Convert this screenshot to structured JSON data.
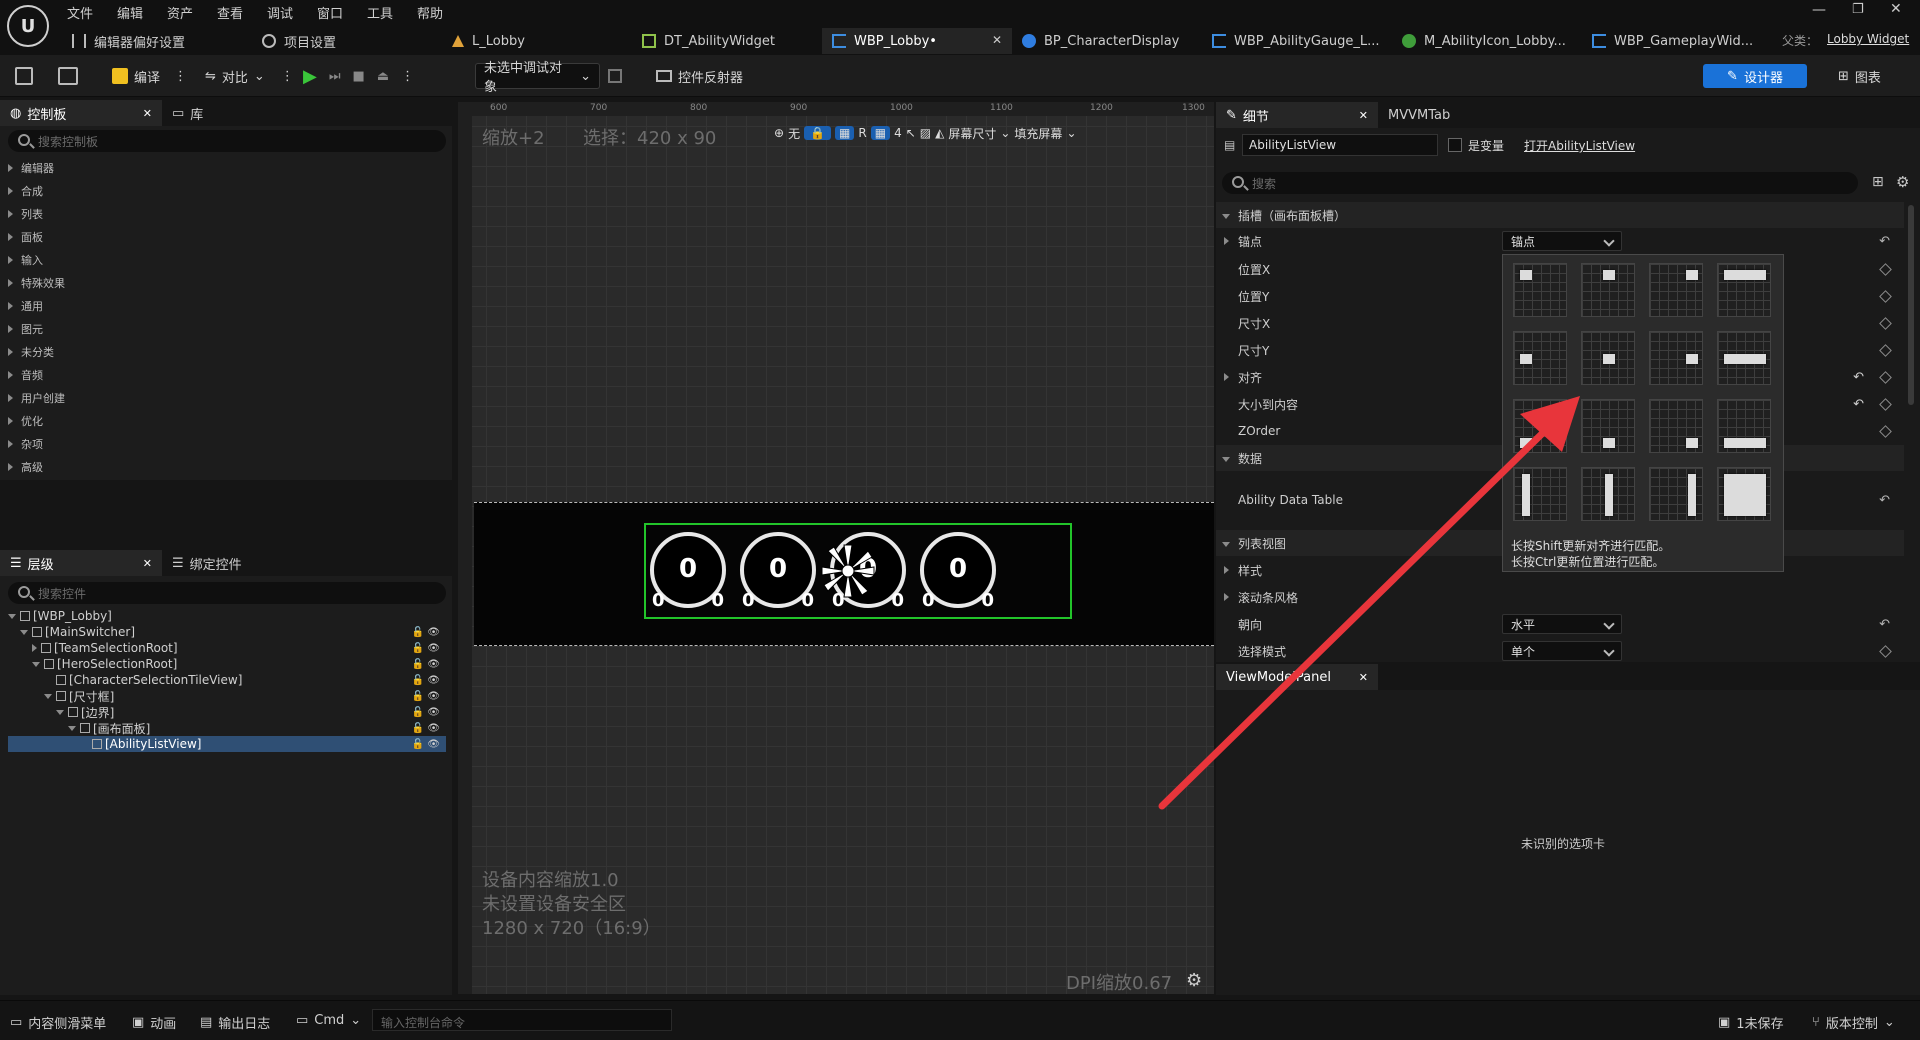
{
  "menu": [
    "文件",
    "编辑",
    "资产",
    "查看",
    "调试",
    "窗口",
    "工具",
    "帮助"
  ],
  "tabs": [
    {
      "label": "编辑器偏好设置"
    },
    {
      "label": "项目设置"
    },
    {
      "label": "L_Lobby"
    },
    {
      "label": "DT_AbilityWidget"
    },
    {
      "label": "WBP_Lobby•"
    },
    {
      "label": "BP_CharacterDisplay"
    },
    {
      "label": "WBP_AbilityGauge_L..."
    },
    {
      "label": "M_AbilityIcon_Lobby..."
    },
    {
      "label": "WBP_GameplayWid..."
    }
  ],
  "parent_class": {
    "label": "父类：",
    "value": "Lobby Widget"
  },
  "toolbar": {
    "compile": "编译",
    "diff": "对比",
    "debug_object": "未选中调试对象",
    "widget_reflector": "控件反射器",
    "designer": "设计器",
    "graph": "图表"
  },
  "palette": {
    "tab": "控制板",
    "library_tab": "库",
    "search_placeholder": "搜索控制板",
    "categories": [
      "编辑器",
      "合成",
      "列表",
      "面板",
      "输入",
      "特殊效果",
      "通用",
      "图元",
      "未分类",
      "音频",
      "用户创建",
      "优化",
      "杂项",
      "高级"
    ]
  },
  "hierarchy": {
    "tab": "层级",
    "bind_tab": "绑定控件",
    "search_placeholder": "搜索控件",
    "items": [
      {
        "label": "[WBP_Lobby]"
      },
      {
        "label": "[MainSwitcher]"
      },
      {
        "label": "[TeamSelectionRoot]"
      },
      {
        "label": "[HeroSelectionRoot]"
      },
      {
        "label": "[CharacterSelectionTileView]"
      },
      {
        "label": "[尺寸框]"
      },
      {
        "label": "[边界]"
      },
      {
        "label": "[画布面板]"
      },
      {
        "label": "[AbilityListView]"
      }
    ]
  },
  "viewport": {
    "zoom": "缩放+2",
    "selection": "选择：420 x 90",
    "ruler": [
      "600",
      "700",
      "800",
      "900",
      "1000",
      "1100",
      "1200",
      "1300"
    ],
    "none_label": "无",
    "r_label": "R",
    "grid_num": "4",
    "screen_size": "屏幕尺寸",
    "fill_screen": "填充屏幕",
    "device_scale": "设备内容缩放1.0",
    "safe_zone": "未设置设备安全区",
    "resolution": "1280 x 720（16:9）",
    "dpi": "DPI缩放0.67",
    "ability_icons": [
      {
        "center": "0",
        "left": "0",
        "right": "0"
      },
      {
        "center": "0",
        "left": "0",
        "right": "0"
      },
      {
        "center": "0",
        "left": "0",
        "right": "0"
      },
      {
        "center": "0",
        "left": "0",
        "right": "0"
      }
    ]
  },
  "details": {
    "tab": "细节",
    "mvvm_tab": "MVVMTab",
    "widget_name": "AbilityListView",
    "is_variable": "是变量",
    "open_link": "打开AbilityListView",
    "search_placeholder": "搜索",
    "slot_section": "插槽（画布面板槽）",
    "anchor": "锚点",
    "anchor_value": "锚点",
    "pos_x": "位置X",
    "pos_y": "位置Y",
    "size_x": "尺寸X",
    "size_y": "尺寸Y",
    "alignment": "对齐",
    "size_to_content": "大小到内容",
    "zorder": "ZOrder",
    "data_section": "数据",
    "ability_data_table": "Ability Data Table",
    "listview_section": "列表视图",
    "style": "样式",
    "scrollbar_style": "滚动条风格",
    "orientation": "朝向",
    "orientation_value": "水平",
    "selection_mode": "选择模式",
    "selection_mode_value": "单个",
    "tip1": "长按Shift更新对齐进行匹配。",
    "tip2": "长按Ctrl更新位置进行匹配。"
  },
  "viewmodel": {
    "tab": "ViewModelPanel",
    "message": "未识别的选项卡"
  },
  "statusbar": {
    "content_drawer": "内容侧滑菜单",
    "animation": "动画",
    "output_log": "输出日志",
    "cmd": "Cmd",
    "console_placeholder": "输入控制台命令",
    "unsaved": "1未保存",
    "source_control": "版本控制"
  },
  "colors": {
    "accent": "#1a72d8",
    "selection_green": "#22c42a",
    "arrow": "#e8353b",
    "selected_row": "#2f4f74"
  }
}
